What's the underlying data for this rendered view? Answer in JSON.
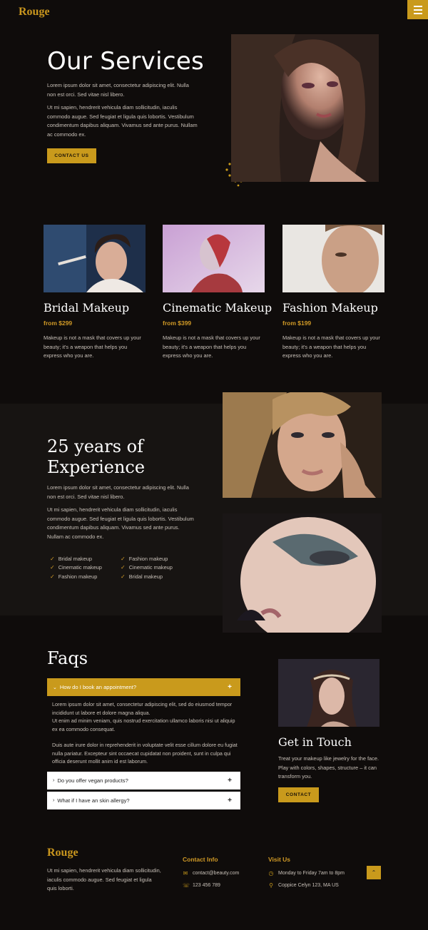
{
  "header": {
    "logo": "Rouge"
  },
  "hero": {
    "title": "Our Services",
    "intro": "Lorem ipsum dolor sit amet, consectetur adipiscing elit. Nulla non est orci. Sed vitae nisl libero.",
    "body": "Ut mi sapien, hendrerit vehicula diam sollicitudin, iaculis commodo augue. Sed feugiat et ligula quis lobortis. Vestibulum condimentum dapibus aliquam. Vivamus sed ante purus. Nullam ac commodo ex.",
    "button": "CONTACT US"
  },
  "services": [
    {
      "title": "Bridal Makeup",
      "price": "from $299",
      "description": "Makeup is not a mask that covers up your beauty; it's a weapon that helps you express who you are."
    },
    {
      "title": "Cinematic Makeup",
      "price": "from $399",
      "description": "Makeup is not a mask that covers up your beauty; it's a weapon that helps you express who you are."
    },
    {
      "title": "Fashion Makeup",
      "price": "from $199",
      "description": "Makeup is not a mask that covers up your beauty; it's a weapon that helps you express who you are."
    }
  ],
  "experience": {
    "title_line1": "25 years of",
    "title_line2": "Experience",
    "intro": "Lorem ipsum dolor sit amet, consectetur adipiscing elit. Nulla non est orci. Sed vitae nisl libero.",
    "body": "Ut mi sapien, hendrerit vehicula diam sollicitudin, iaculis commodo augue. Sed feugiat et ligula quis lobortis. Vestibulum condimentum dapibus aliquam. Vivamus sed ante purus. Nullam ac commodo ex.",
    "list_left": [
      "Bridal makeup",
      "Cinematic makeup",
      "Fashion makeup"
    ],
    "list_right": [
      "Fashion makeup",
      "Cinematic makeup",
      "Bridal makeup"
    ]
  },
  "faqs": {
    "title": "Faqs",
    "items": [
      {
        "question": "How do I book an appointment?",
        "answer_p1": "Lorem ipsum dolor sit amet, consectetur adipiscing elit, sed do eiusmod tempor incididunt ut labore et dolore magna aliqua.",
        "answer_p2": "Ut enim ad minim veniam, quis nostrud exercitation ullamco laboris nisi ut aliquip ex ea commodo consequat.",
        "answer_p3": "Duis aute irure dolor in reprehenderit in voluptate velit esse cillum dolore eu fugiat nulla pariatur. Excepteur sint occaecat cupidatat non proident, sunt in culpa qui officia deserunt mollit anim id est laborum."
      },
      {
        "question": "Do you offer vegan products?"
      },
      {
        "question": "What if I have an skin allergy?"
      }
    ]
  },
  "touch": {
    "title": "Get in Touch",
    "body": "Treat your makeup like jewelry for the face. Play with colors, shapes, structure – it can transform you.",
    "button": "CONTACT"
  },
  "footer": {
    "logo": "Rouge",
    "about": "Ut mi sapien, hendrerit vehicula diam sollicitudin, iaculis commodo augue. Sed feugiat et ligula quis loborti.",
    "contact_title": "Contact Info",
    "email": "contact@beauty.com",
    "phone": "123 456 789",
    "visit_title": "Visit Us",
    "hours": "Monday to Friday 7am to 8pm",
    "address": "Coppice Celyn 123, MA US"
  },
  "colors": {
    "accent": "#c99a1c",
    "background": "#0f0c0b"
  },
  "icons": [
    "menu-icon",
    "check-icon",
    "chevron-down-icon",
    "chevron-right-icon",
    "plus-icon",
    "envelope-icon",
    "phone-icon",
    "clock-icon",
    "map-pin-icon",
    "arrow-up-icon"
  ]
}
